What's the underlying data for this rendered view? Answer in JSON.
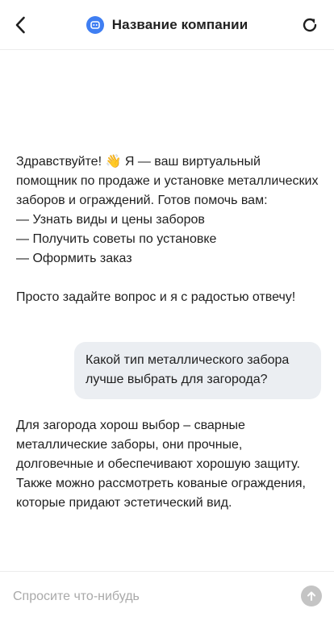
{
  "header": {
    "back_icon": "chevron-left-icon",
    "logo_icon": "chatbot-icon",
    "title": "Название компании",
    "refresh_icon": "refresh-icon",
    "logo_color": "#3f7ef2"
  },
  "messages": {
    "bot_greeting": {
      "line1": "Здравствуйте! 👋 Я — ваш виртуальный помощник по продаже и установке металлических заборов и ограждений. Готов помочь вам:",
      "option1": "— Узнать виды и цены заборов",
      "option2": "— Получить советы по установке",
      "option3": "— Оформить заказ",
      "closing": "Просто задайте вопрос и я с радостью отвечу!"
    },
    "user_question": "Какой тип металлического забора лучше выбрать для загорода?",
    "bot_answer": "Для загорода хорош выбор – сварные металлические заборы, они прочные, долговечные и обеспечивают хорошую защиту. Также можно рассмотреть кованые ограждения, которые придают эстетический вид."
  },
  "composer": {
    "placeholder": "Спросите что-нибудь",
    "value": "",
    "send_icon": "arrow-up-icon"
  }
}
